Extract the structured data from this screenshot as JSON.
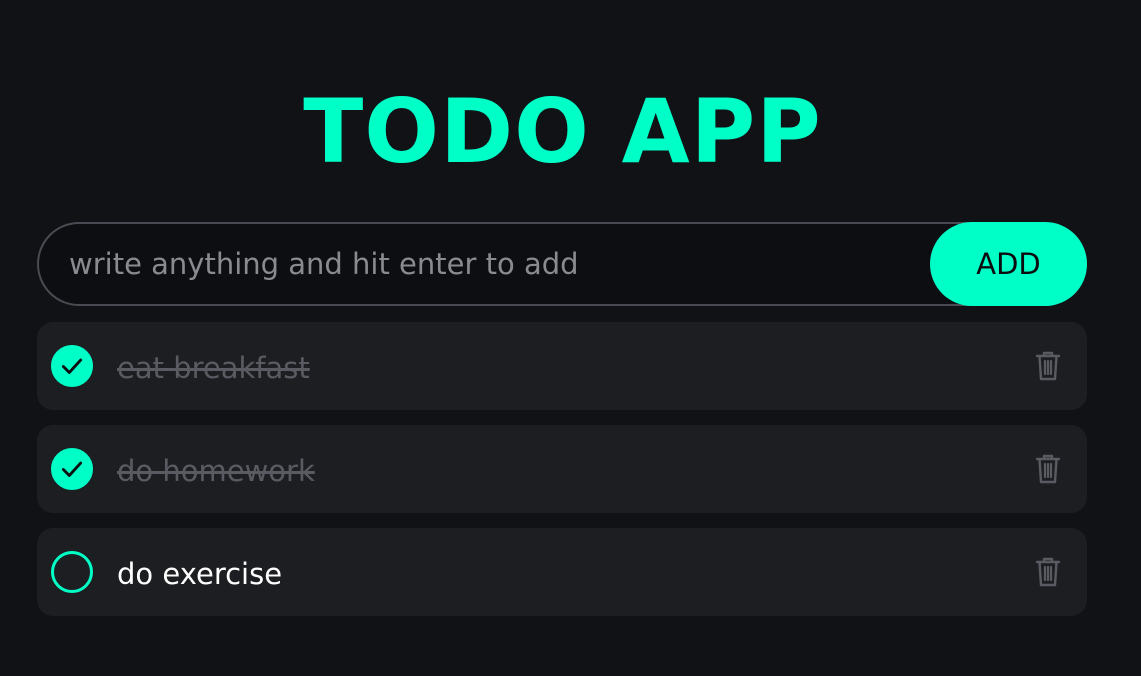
{
  "app": {
    "title": "TODO APP"
  },
  "input": {
    "placeholder": "write anything and hit enter to add",
    "value": ""
  },
  "add_button": {
    "label": "ADD"
  },
  "todos": [
    {
      "text": "eat breakfast",
      "completed": true
    },
    {
      "text": "do homework",
      "completed": true
    },
    {
      "text": "do exercise",
      "completed": false
    }
  ],
  "colors": {
    "accent": "#00ffc6",
    "background": "#111216",
    "card": "#1d1e22",
    "muted_text": "#5a5b62"
  },
  "icons": {
    "check": "check-icon",
    "delete": "trash-icon"
  }
}
